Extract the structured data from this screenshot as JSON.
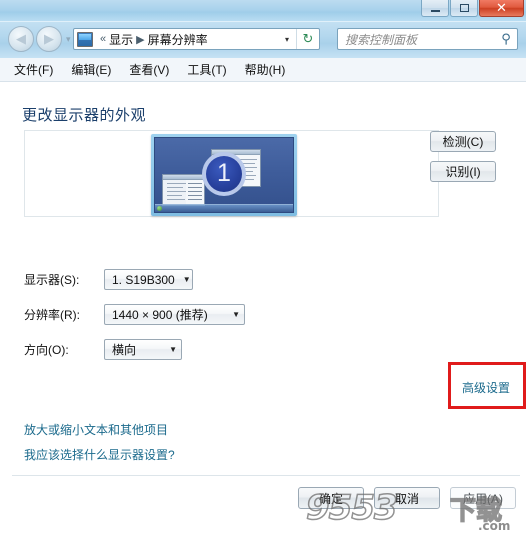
{
  "window": {
    "controls": {
      "minimize_label": "Minimize",
      "maximize_label": "Maximize",
      "close_label": "✕"
    }
  },
  "nav": {
    "back_label": "◀",
    "forward_label": "▶",
    "separator": "▾",
    "address_icon": "display-icon",
    "breadcrumb": {
      "prefix": "«",
      "items": [
        "显示",
        "屏幕分辨率"
      ],
      "chevron": "▶"
    },
    "dropdown_caret": "▾",
    "refresh_glyph": "↻"
  },
  "search": {
    "placeholder": "搜索控制面板",
    "icon": "⚲"
  },
  "menubar": {
    "items": [
      "文件(F)",
      "编辑(E)",
      "查看(V)",
      "工具(T)",
      "帮助(H)"
    ]
  },
  "main": {
    "page_title": "更改显示器的外观",
    "monitor_preview": {
      "badge_number": "1"
    },
    "side_buttons": [
      {
        "label": "检测(C)"
      },
      {
        "label": "识别(I)"
      }
    ],
    "form": {
      "display": {
        "label": "显示器(S):",
        "value": "1. S19B300",
        "caret": "▼"
      },
      "resolution": {
        "label": "分辨率(R):",
        "value": "1440 × 900 (推荐)",
        "caret": "▼"
      },
      "orientation": {
        "label": "方向(O):",
        "value": "横向",
        "caret": "▼"
      }
    },
    "advanced_link": "高级设置",
    "footer_links": [
      "放大或缩小文本和其他项目",
      "我应该选择什么显示器设置?"
    ],
    "footer_buttons": [
      {
        "label": "确定"
      },
      {
        "label": "取消"
      },
      {
        "label": "应用(A)"
      }
    ]
  },
  "annotation": {
    "highlight_color": "#e01b1b"
  },
  "watermark": {
    "main": "9553",
    "cn": "下载",
    "domain": ".com"
  }
}
